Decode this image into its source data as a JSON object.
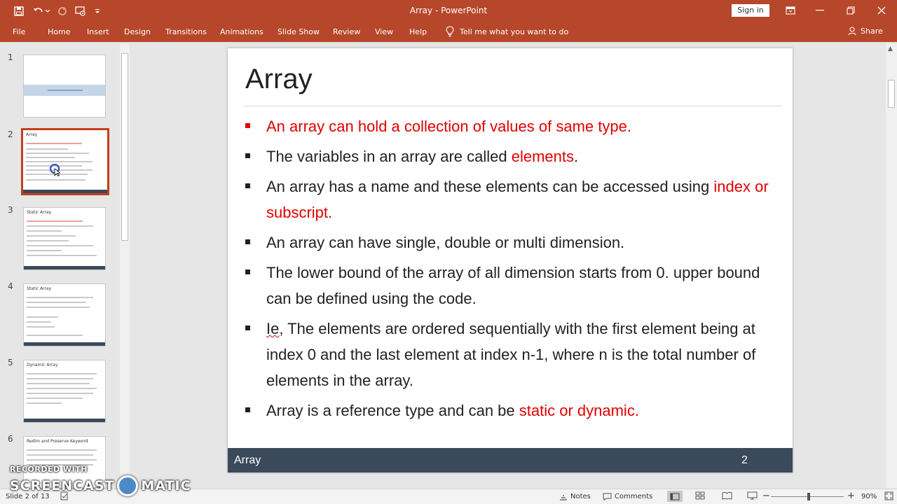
{
  "app": {
    "title": "Array  -  PowerPoint",
    "sign_in_label": "Sign in",
    "colors": {
      "brand": "#b7472a",
      "accent_red": "#e00000",
      "footer": "#3b4a5a"
    }
  },
  "ribbon": {
    "tabs": [
      "File",
      "Home",
      "Insert",
      "Design",
      "Transitions",
      "Animations",
      "Slide Show",
      "Review",
      "View",
      "Help"
    ],
    "tell_me": "Tell me what you want to do",
    "share": "Share"
  },
  "thumbnails": {
    "numbers": [
      "1",
      "2",
      "3",
      "4",
      "5",
      "6"
    ],
    "titles": [
      "",
      "Array",
      "Static Array",
      "Static Array",
      "Dynamic Array",
      "Redim and Preserve Keyword"
    ]
  },
  "slide": {
    "title": "Array",
    "bullets": [
      {
        "red_mark": true,
        "parts": [
          {
            "t": "An array can hold a collection of values of same type.",
            "red": true
          }
        ]
      },
      {
        "red_mark": false,
        "parts": [
          {
            "t": "The variables in an array are called "
          },
          {
            "t": "elements",
            "red": true
          },
          {
            "t": "."
          }
        ]
      },
      {
        "red_mark": false,
        "parts": [
          {
            "t": "An array has a name and these elements can be accessed using "
          },
          {
            "t": "index or subscript.",
            "red": true
          }
        ]
      },
      {
        "red_mark": false,
        "parts": [
          {
            "t": "An array can have single, double or multi dimension."
          }
        ]
      },
      {
        "red_mark": false,
        "parts": [
          {
            "t": "The lower bound of the array of all dimension starts from 0. upper bound can be defined using the code."
          }
        ]
      },
      {
        "red_mark": false,
        "parts": [
          {
            "t": "Ie",
            "squig": true
          },
          {
            "t": ", The elements are ordered sequentially with the first element being at index 0 and the last element at index n-1, where n is the total number of elements in the array."
          }
        ]
      },
      {
        "red_mark": false,
        "parts": [
          {
            "t": "Array is a reference type and can be "
          },
          {
            "t": "static or dynamic.",
            "red": true
          }
        ]
      }
    ],
    "footer_left": "Array",
    "footer_right": "2"
  },
  "statusbar": {
    "slide_info": "Slide 2 of 13",
    "notes": "Notes",
    "comments": "Comments",
    "zoom": "90%",
    "zoom_level_percent": 90
  },
  "watermark": {
    "line1": "RECORDED WITH",
    "line2a": "SCREENCAST",
    "line2b": "MATIC"
  }
}
